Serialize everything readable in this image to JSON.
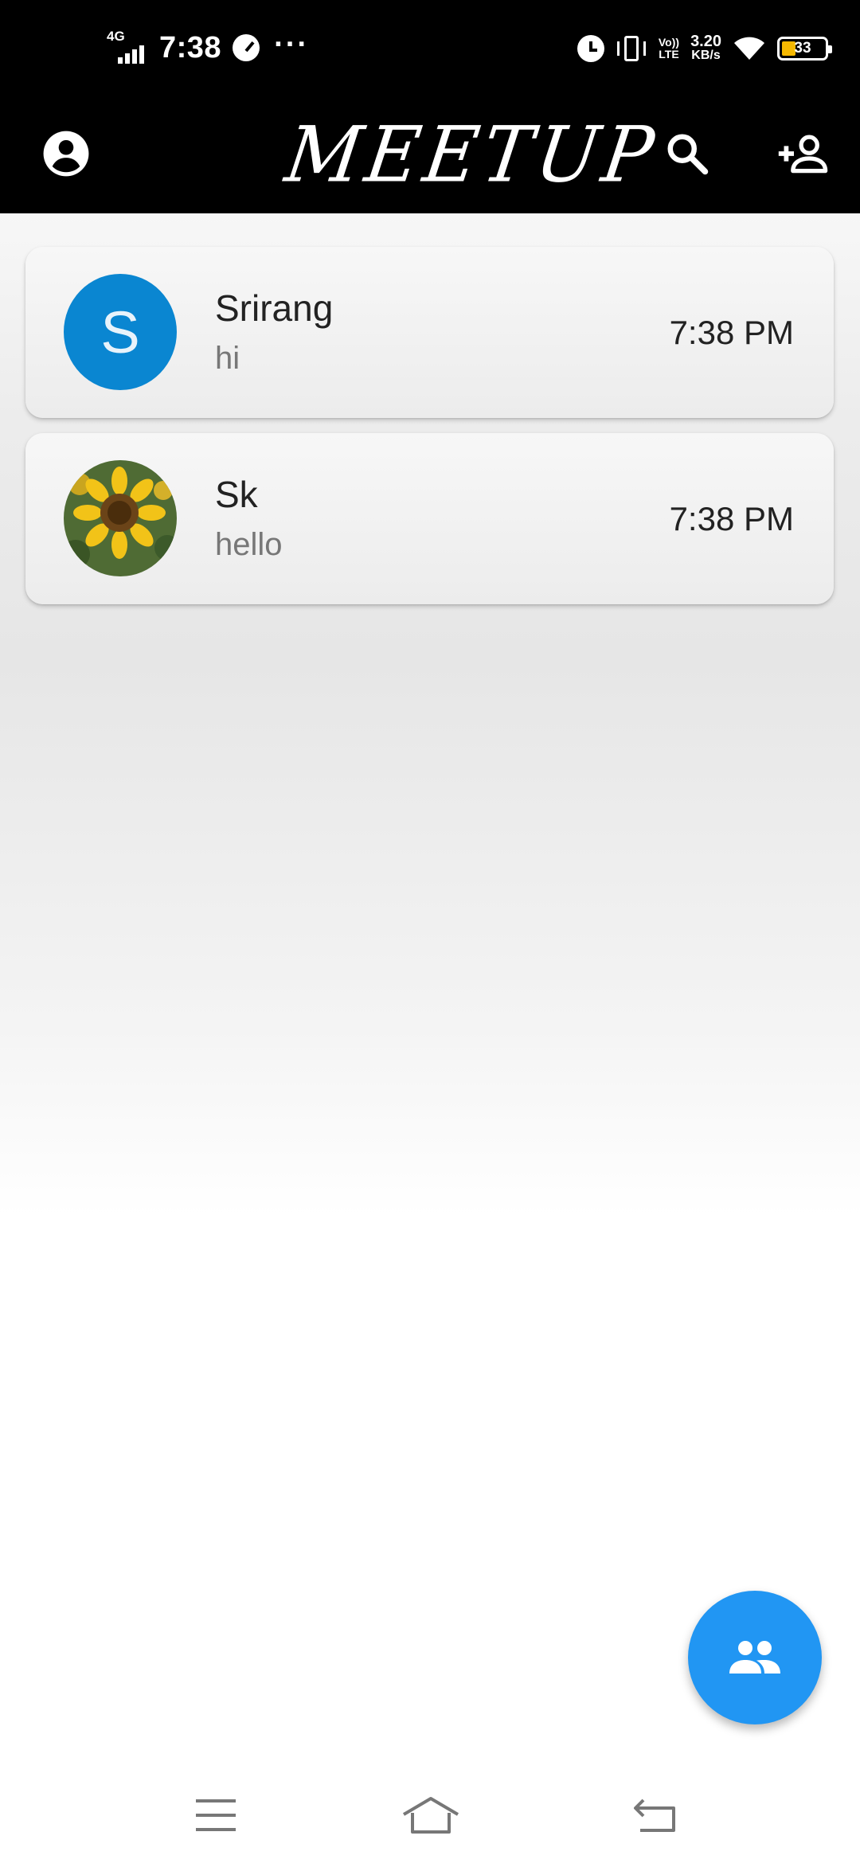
{
  "status_bar": {
    "network": "4G",
    "time": "7:38",
    "more": "···",
    "volte_line1": "Vo))",
    "volte_line2": "LTE",
    "net_speed_value": "3.20",
    "net_speed_unit": "KB/s",
    "battery_level": "33",
    "battery_fill_percent": 33,
    "battery_color": "#f5b800"
  },
  "app_bar": {
    "title": "MEETUP",
    "profile_icon": "account-circle-icon",
    "search_icon": "search-icon",
    "add_contact_icon": "person-add-icon",
    "background": "#000000"
  },
  "chats": [
    {
      "name": "Srirang",
      "avatar_type": "letter",
      "avatar_letter": "S",
      "avatar_color": "#0a86d1",
      "last_message": "hi",
      "time": "7:38 PM"
    },
    {
      "name": "Sk",
      "avatar_type": "image",
      "avatar_image": "sunflower-photo",
      "last_message": "hello",
      "time": "7:38 PM"
    }
  ],
  "fab": {
    "icon": "group-icon",
    "color": "#2196f3"
  },
  "nav_bar": {
    "menu_icon": "menu-icon",
    "home_icon": "home-icon",
    "back_icon": "back-icon"
  }
}
